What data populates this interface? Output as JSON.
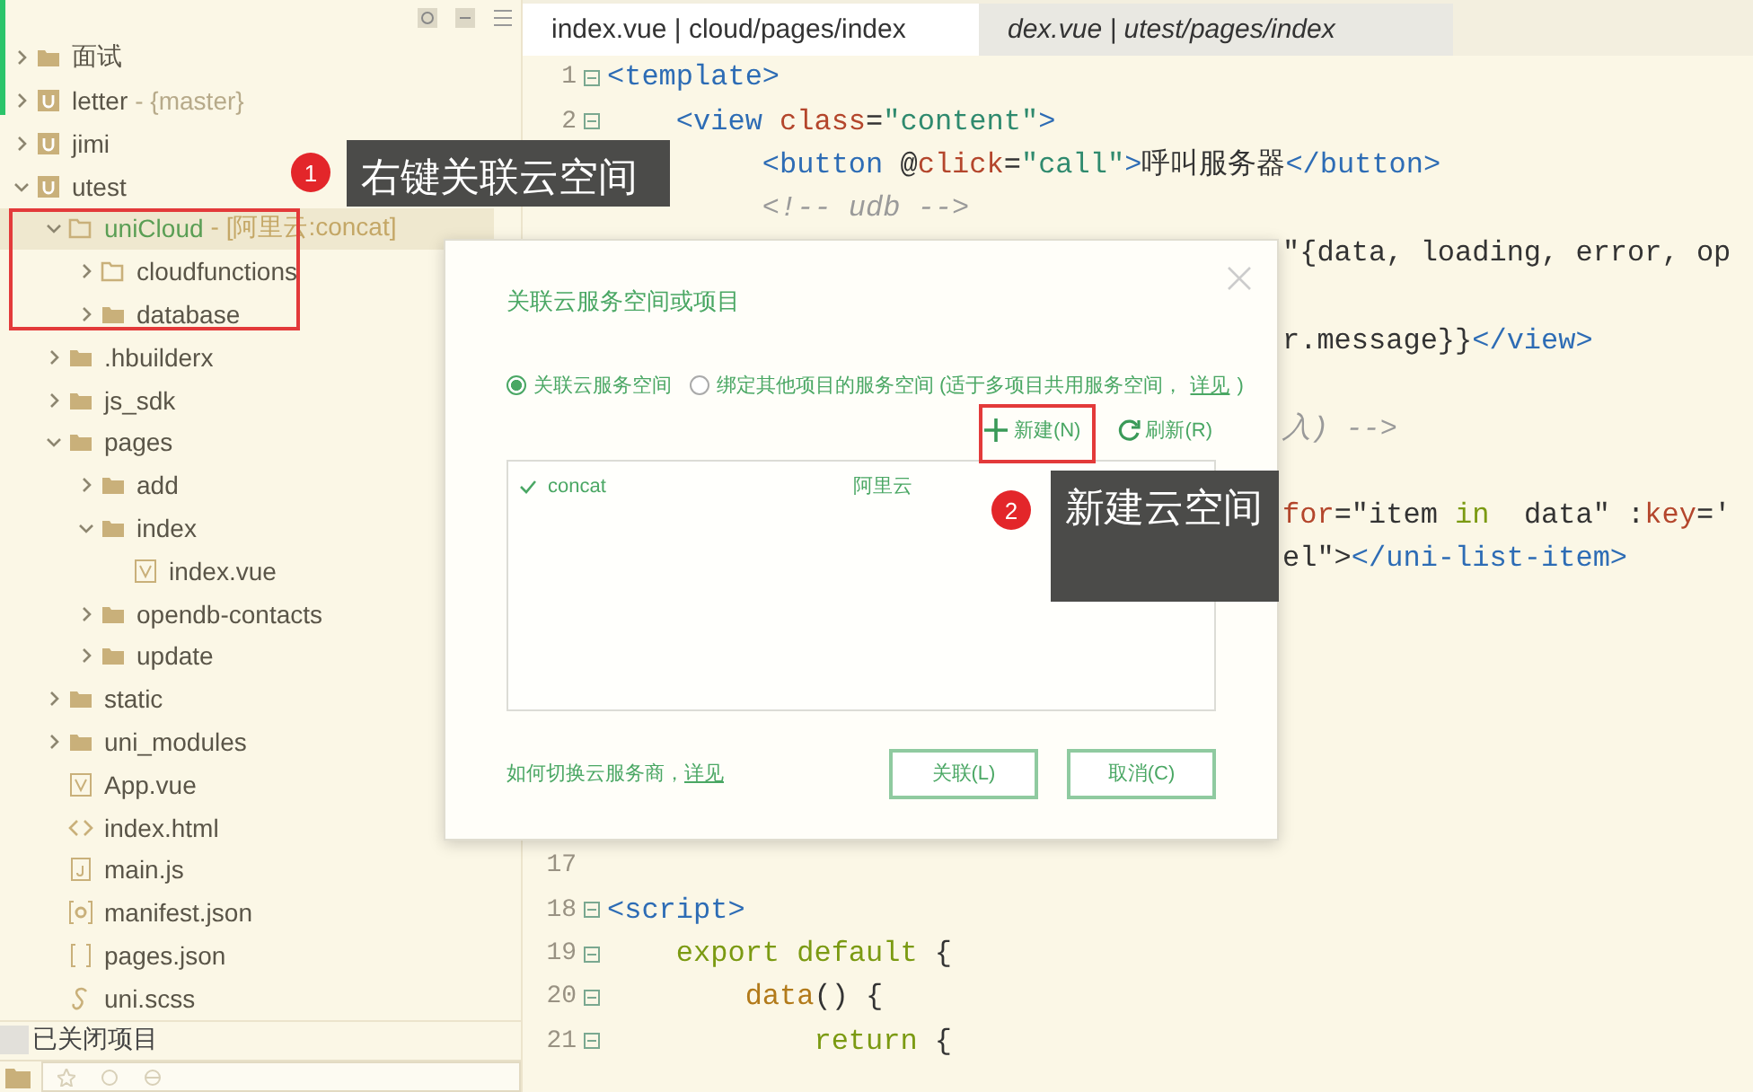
{
  "sidebar": {
    "tree": [
      {
        "label": "面试",
        "kind": "folder",
        "expanded": false,
        "selected": false
      },
      {
        "label": "letter",
        "suffix": "- {master}",
        "kind": "project",
        "expanded": false,
        "selected": false
      },
      {
        "label": "jimi",
        "kind": "project",
        "expanded": false,
        "selected": false
      },
      {
        "label": "utest",
        "kind": "project",
        "expanded": true,
        "selected": false,
        "children": [
          {
            "label": "uniCloud",
            "suffix": "- [阿里云:concat]",
            "kind": "cloud",
            "expanded": true,
            "selected": true,
            "children": [
              {
                "label": "cloudfunctions",
                "kind": "open-folder",
                "expanded": false,
                "selected": false
              },
              {
                "label": "database",
                "kind": "folder",
                "expanded": false,
                "selected": false
              }
            ]
          },
          {
            "label": ".hbuilderx",
            "kind": "folder",
            "expanded": false,
            "selected": false
          },
          {
            "label": "js_sdk",
            "kind": "folder",
            "expanded": false,
            "selected": false
          },
          {
            "label": "pages",
            "kind": "folder",
            "expanded": true,
            "selected": false,
            "children": [
              {
                "label": "add",
                "kind": "folder",
                "expanded": false,
                "selected": false
              },
              {
                "label": "index",
                "kind": "folder",
                "expanded": true,
                "selected": false,
                "children": [
                  {
                    "label": "index.vue",
                    "kind": "vue",
                    "selected": false
                  }
                ]
              },
              {
                "label": "opendb-contacts",
                "kind": "folder",
                "expanded": false,
                "selected": false
              },
              {
                "label": "update",
                "kind": "folder",
                "expanded": false,
                "selected": false
              }
            ]
          },
          {
            "label": "static",
            "kind": "folder",
            "expanded": false,
            "selected": false
          },
          {
            "label": "uni_modules",
            "kind": "folder",
            "expanded": false,
            "selected": false
          },
          {
            "label": "App.vue",
            "kind": "vue",
            "selected": false
          },
          {
            "label": "index.html",
            "kind": "html",
            "selected": false
          },
          {
            "label": "main.js",
            "kind": "js",
            "selected": false
          },
          {
            "label": "manifest.json",
            "kind": "manifest",
            "selected": false
          },
          {
            "label": "pages.json",
            "kind": "json",
            "selected": false
          },
          {
            "label": "uni.scss",
            "kind": "scss",
            "selected": false
          }
        ]
      }
    ],
    "closed_projects": "已关闭项目"
  },
  "editor": {
    "tabs": [
      {
        "label": "index.vue | cloud/pages/index",
        "selected": true
      },
      {
        "label": "dex.vue | utest/pages/index",
        "selected": false
      }
    ],
    "lines": [
      {
        "kind": "code",
        "number": "1",
        "fold": true,
        "tokens": [
          {
            "kind": "tag",
            "text": "<template>"
          }
        ]
      },
      {
        "kind": "code",
        "number": "2",
        "fold": true,
        "tokens": [
          {
            "kind": "tag",
            "text": "    <view"
          },
          {
            "kind": "attr",
            "text": " class"
          },
          {
            "kind": "text",
            "text": "="
          },
          {
            "kind": "str",
            "text": "\"content\""
          },
          {
            "kind": "tag",
            "text": ">"
          }
        ]
      },
      {
        "kind": "code",
        "tokens": [
          {
            "kind": "tag",
            "text": "         <button"
          },
          {
            "kind": "text",
            "text": " @"
          },
          {
            "kind": "attr",
            "text": "click"
          },
          {
            "kind": "text",
            "text": "="
          },
          {
            "kind": "str",
            "text": "\"call\""
          },
          {
            "kind": "tag",
            "text": ">"
          },
          {
            "kind": "text",
            "text": "呼叫服务器"
          },
          {
            "kind": "tag",
            "text": "</button>"
          }
        ]
      },
      {
        "kind": "code",
        "tokens": [
          {
            "kind": "comment",
            "text": "         <!-- udb -->"
          }
        ]
      },
      {
        "kind": "clipped",
        "tokens": [
          {
            "kind": "text",
            "text": "\"{data, loading, error, op"
          }
        ]
      },
      {
        "kind": "blank"
      },
      {
        "kind": "clipped",
        "tokens": [
          {
            "kind": "text",
            "text": "r.message}}"
          },
          {
            "kind": "tag",
            "text": "</view>"
          }
        ]
      },
      {
        "kind": "blank"
      },
      {
        "kind": "clipped",
        "tokens": [
          {
            "kind": "comment",
            "text": "入) -->"
          }
        ]
      },
      {
        "kind": "blank"
      },
      {
        "kind": "clipped",
        "tokens": [
          {
            "kind": "attr",
            "text": "for"
          },
          {
            "kind": "text",
            "text": "=\"item "
          },
          {
            "kind": "kw",
            "text": "in"
          },
          {
            "kind": "text",
            "text": "  data\" :"
          },
          {
            "kind": "attr",
            "text": "key"
          },
          {
            "kind": "text",
            "text": "='"
          }
        ]
      },
      {
        "kind": "clipped",
        "tokens": [
          {
            "kind": "text",
            "text": "el\">"
          },
          {
            "kind": "tag",
            "text": "</uni-list-item>"
          }
        ]
      },
      {
        "kind": "blank"
      },
      {
        "kind": "blank"
      },
      {
        "kind": "blank"
      },
      {
        "kind": "blank"
      },
      {
        "kind": "blank"
      },
      {
        "kind": "blank"
      },
      {
        "kind": "code",
        "number": "17"
      },
      {
        "kind": "code",
        "number": "18",
        "fold": true,
        "tokens": [
          {
            "kind": "tag",
            "text": "<script>"
          }
        ]
      },
      {
        "kind": "code",
        "number": "19",
        "fold": true,
        "tokens": [
          {
            "kind": "kw",
            "text": "    export default"
          },
          {
            "kind": "text",
            "text": " {"
          }
        ]
      },
      {
        "kind": "code",
        "number": "20",
        "fold": true,
        "tokens": [
          {
            "kind": "fn",
            "text": "        data"
          },
          {
            "kind": "text",
            "text": "() {"
          }
        ]
      },
      {
        "kind": "code",
        "number": "21",
        "fold": true,
        "tokens": [
          {
            "kind": "kw",
            "text": "            return"
          },
          {
            "kind": "text",
            "text": " {"
          }
        ]
      }
    ]
  },
  "dialog": {
    "title": "关联云服务空间或项目",
    "options": [
      {
        "label": "关联云服务空间",
        "selected": true
      },
      {
        "label": "绑定其他项目的服务空间 (适于多项目共用服务空间，",
        "link": "详见",
        "after": ")",
        "selected": false
      }
    ],
    "actions": [
      {
        "kind": "new",
        "label": "新建(N)"
      },
      {
        "kind": "refresh",
        "label": "刷新(R)"
      }
    ],
    "spaces": [
      {
        "name": "concat",
        "provider": "阿里云",
        "checked": true
      }
    ],
    "help": {
      "text": "如何切换云服务商，",
      "link": "详见"
    },
    "buttons": [
      "关联(L)",
      "取消(C)"
    ]
  },
  "annotations": [
    {
      "number": "1",
      "text": "右键关联云空间"
    },
    {
      "number": "2",
      "text": "新建云空间"
    }
  ]
}
